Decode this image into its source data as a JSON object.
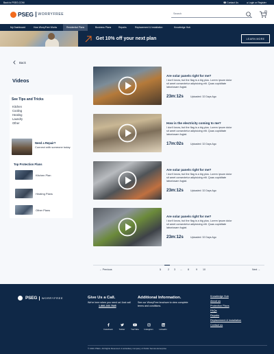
{
  "topbar": {
    "back": "Back to PSEG.COM",
    "contact": "Contact Us",
    "login": "Login or Register"
  },
  "header": {
    "brand": "PSEG",
    "sub_brand": "WORRYFREE",
    "search_placeholder": "Search",
    "cart_count": "0"
  },
  "nav": {
    "items": [
      {
        "label": "My Dashboard"
      },
      {
        "label": "How WorryFree Works"
      },
      {
        "label": "Residential Plans"
      },
      {
        "label": "Business Plans"
      },
      {
        "label": "Repairs"
      },
      {
        "label": "Replacement & Installation"
      },
      {
        "label": "Knowledge Hub"
      }
    ],
    "active_index": 2
  },
  "promo": {
    "text": "Get 10% off your next plan",
    "button": "LEARN MORE"
  },
  "back_label": "Back",
  "page_title": "Videos",
  "sidebar": {
    "tips_title": "See Tips and Tricks",
    "tips": [
      "Kitchen",
      "Cooling",
      "Heating",
      "Laundry",
      "Other"
    ],
    "repair_title": "Need a Repair?",
    "repair_sub": "Connect with someone today",
    "plans_title": "Top Protection Plans",
    "plans": [
      {
        "label": "Kitchen Plan"
      },
      {
        "label": "Heating Plans"
      },
      {
        "label": "Other Plans"
      }
    ]
  },
  "videos": [
    {
      "title": "Are solar panels right for me?",
      "desc": "I don't know, but the flag is a big plus. Lorem ipsum dolor sit amet consectetur adipisicing elit. Quas cupiditate laboriosam fugiat.",
      "duration": "23m:12s",
      "uploaded": "Uploaded: 32 Days Ago"
    },
    {
      "title": "How is the electricity coming to me?",
      "desc": "I don't know, but the flag is a big plus. Lorem ipsum dolor sit amet consectetur adipisicing elit. Quas cupiditate laboriosam fugiat.",
      "duration": "17m:02s",
      "uploaded": "Uploaded: 32 Days Ago"
    },
    {
      "title": "Are solar panels right for me?",
      "desc": "I don't know, but the flag is a big plus. Lorem ipsum dolor sit amet consectetur adipisicing elit. Quas cupiditate laboriosam fugiat.",
      "duration": "23m:12s",
      "uploaded": "Uploaded: 32 Days Ago"
    },
    {
      "title": "Are solar panels right for me?",
      "desc": "I don't know, but the flag is a big plus. Lorem ipsum dolor sit amet consectetur adipisicing elit. Quas cupiditate laboriosam fugiat.",
      "duration": "23m:12s",
      "uploaded": "Uploaded: 32 Days Ago"
    }
  ],
  "pagination": {
    "prev": "Previous",
    "next": "Next",
    "pages": [
      "1",
      "2",
      "3",
      "...",
      "8",
      "9",
      "10"
    ],
    "active": "1"
  },
  "footer": {
    "brand": "PSEG",
    "sub_brand": "WORRYFREE",
    "call_title": "Give Us a Call.",
    "call_text": "We're here when you need us! Just call",
    "call_phone": "1-866-245-7845",
    "info_title": "Additional Information.",
    "info_text": "See our WorryFree brochure to view complete terms and conditions.",
    "links": [
      "Knowledge Hub",
      "About us",
      "Protection Plans",
      "FAQs",
      "Repairs",
      "Replacement & Installation",
      "Contact us"
    ],
    "social": [
      {
        "label": "Facebook",
        "icon": "facebook-icon"
      },
      {
        "label": "Twitter",
        "icon": "twitter-icon"
      },
      {
        "label": "YouTube",
        "icon": "youtube-icon"
      },
      {
        "label": "Instagram",
        "icon": "instagram-icon"
      },
      {
        "label": "LinkedIn",
        "icon": "linkedin-icon"
      }
    ],
    "copyright": "© 2021 PSEG. All Rights Reserved. A subsidiary company of Public Service Enterprise"
  }
}
